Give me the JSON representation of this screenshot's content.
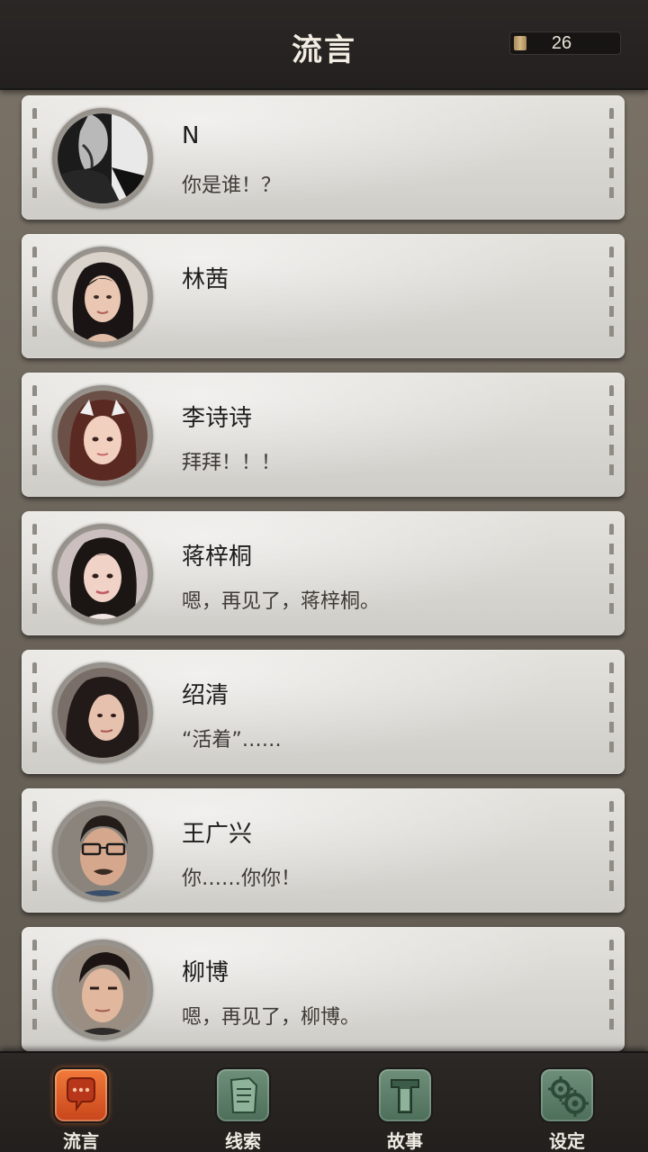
{
  "header": {
    "title": "流言",
    "coin_count": "26"
  },
  "chats": [
    {
      "name": "N",
      "message": "你是谁！？"
    },
    {
      "name": "林茜",
      "message": ""
    },
    {
      "name": "李诗诗",
      "message": "拜拜！！！"
    },
    {
      "name": "蒋梓桐",
      "message": "嗯，再见了，蒋梓桐。"
    },
    {
      "name": "绍清",
      "message": "“活着”……"
    },
    {
      "name": "王广兴",
      "message": "你……你你！"
    },
    {
      "name": "柳博",
      "message": "嗯，再见了，柳博。"
    }
  ],
  "tabs": [
    {
      "label": "流言",
      "active": true,
      "icon": "chat-bubble-icon"
    },
    {
      "label": "线索",
      "active": false,
      "icon": "document-icon"
    },
    {
      "label": "故事",
      "active": false,
      "icon": "book-icon"
    },
    {
      "label": "设定",
      "active": false,
      "icon": "gear-icon"
    }
  ]
}
